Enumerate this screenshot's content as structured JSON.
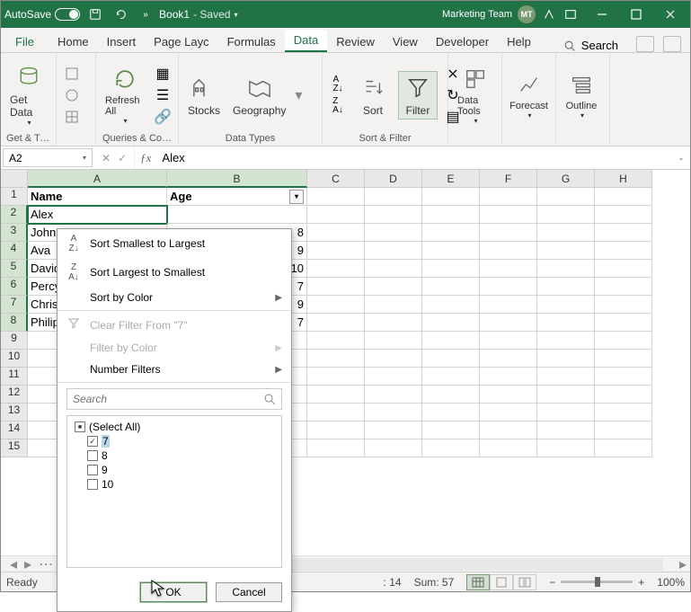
{
  "titlebar": {
    "autosave": "AutoSave",
    "toggle": "On",
    "book": "Book1",
    "saved": " - Saved",
    "team": "Marketing Team",
    "initials": "MT"
  },
  "tabs": {
    "file": "File",
    "home": "Home",
    "insert": "Insert",
    "pagelayout": "Page Layc",
    "formulas": "Formulas",
    "data": "Data",
    "review": "Review",
    "view": "View",
    "developer": "Developer",
    "help": "Help",
    "search": "Search"
  },
  "ribbon": {
    "get_data": "Get Data",
    "get_transform": "Get & Transform…",
    "refresh_all": "Refresh All",
    "queries": "Queries & Co…",
    "stocks": "Stocks",
    "geography": "Geography",
    "data_types": "Data Types",
    "sort_group": "Sort & Filter",
    "az": "A↓Z",
    "za": "Z↓A",
    "sort": "Sort",
    "filter": "Filter",
    "data_tools": "Data Tools",
    "forecast": "Forecast",
    "outline": "Outline"
  },
  "namebox": "A2",
  "formula": "Alex",
  "columns": [
    "A",
    "B",
    "C",
    "D",
    "E",
    "F",
    "G",
    "H"
  ],
  "col_widths": {
    "A": 155,
    "B": 156,
    "C": 64,
    "D": 64,
    "E": 64,
    "F": 64,
    "G": 64,
    "H": 64
  },
  "rows": [
    {
      "n": 1,
      "A": "Name",
      "B": "Age",
      "header": true
    },
    {
      "n": 2,
      "A": "Alex",
      "B": ""
    },
    {
      "n": 3,
      "A": "John",
      "B": "8"
    },
    {
      "n": 4,
      "A": "Ava",
      "B": "9"
    },
    {
      "n": 5,
      "A": "David",
      "B": "10"
    },
    {
      "n": 6,
      "A": "Percy",
      "B": "7"
    },
    {
      "n": 7,
      "A": "Christopher",
      "B": "9"
    },
    {
      "n": 8,
      "A": "Philip",
      "B": "7"
    },
    {
      "n": 9,
      "A": "",
      "B": ""
    },
    {
      "n": 10,
      "A": "",
      "B": ""
    },
    {
      "n": 11,
      "A": "",
      "B": ""
    },
    {
      "n": 12,
      "A": "",
      "B": ""
    },
    {
      "n": 13,
      "A": "",
      "B": ""
    },
    {
      "n": 14,
      "A": "",
      "B": ""
    },
    {
      "n": 15,
      "A": "",
      "B": ""
    }
  ],
  "status": {
    "ready": "Ready",
    "count": ": 14",
    "sum": "Sum: 57",
    "zoom": "100%"
  },
  "filter": {
    "sort_asc": "Sort Smallest to Largest",
    "sort_desc": "Sort Largest to Smallest",
    "sort_color": "Sort by Color",
    "clear": "Clear Filter From \"7\"",
    "filter_color": "Filter by Color",
    "number_filters": "Number Filters",
    "search_placeholder": "Search",
    "items": {
      "select_all": "(Select All)",
      "v7": "7",
      "v8": "8",
      "v9": "9",
      "v10": "10"
    },
    "ok": "OK",
    "cancel": "Cancel"
  }
}
